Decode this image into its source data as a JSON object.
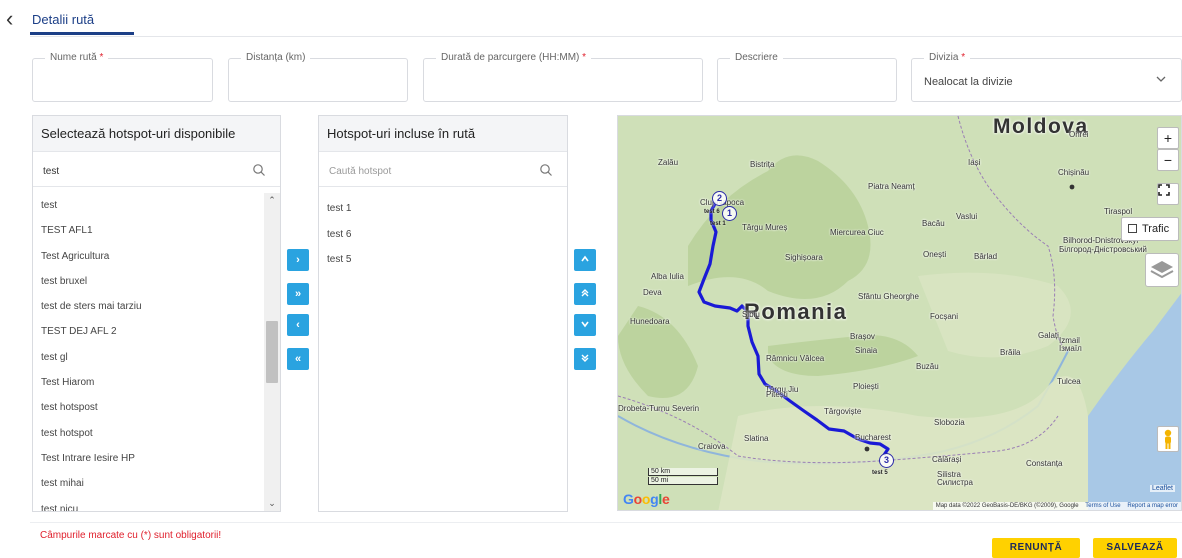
{
  "header": {
    "back_icon": "chevron-left-icon",
    "tab_label": "Detalii rută"
  },
  "form": {
    "route_name": {
      "label": "Nume rută",
      "required_mark": "*",
      "value": ""
    },
    "distance": {
      "label": "Distanța (km)",
      "value": ""
    },
    "duration": {
      "label": "Durată de parcurgere (HH:MM)",
      "required_mark": "*",
      "value": ""
    },
    "description": {
      "label": "Descriere",
      "value": ""
    },
    "division": {
      "label": "Divizia",
      "required_mark": "*",
      "value": "Nealocat la divizie"
    }
  },
  "available": {
    "title": "Selectează hotspot-uri disponibile",
    "search_value": "test",
    "items": [
      "test",
      "TEST AFL1",
      "Test Agricultura",
      "test bruxel",
      "test de sters mai tarziu",
      "TEST DEJ AFL 2",
      "test gl",
      "Test Hiarom",
      "test hotspost",
      "test hotspot",
      "Test Intrare Iesire HP",
      "test mihai",
      "test nicu"
    ]
  },
  "transfer_buttons": {
    "move_right": "›",
    "move_all_right": "»",
    "move_left": "‹",
    "move_all_left": "«"
  },
  "included": {
    "title": "Hotspot-uri incluse în rută",
    "search_placeholder": "Caută hotspot",
    "items": [
      "test 1",
      "test 6",
      "test 5"
    ]
  },
  "order_buttons": {
    "up": "˄",
    "top": "«",
    "down": "˅",
    "bottom": "»"
  },
  "map": {
    "country_labels": {
      "moldova": "Moldova",
      "romania": "Romania"
    },
    "city_labels": [
      "Zalău",
      "Bistrița",
      "Piatra Neamț",
      "Iași",
      "Chișinău",
      "Cluj-Napoca",
      "Târgu Mureș",
      "Bacău",
      "Vaslui",
      "Tiraspol",
      "Miercurea Ciuc",
      "Onești",
      "Bârlad",
      "Bilhorod-Dnistrovskyi",
      "Білгород-Дністровський",
      "Sighișoara",
      "Alba Iulia",
      "Deva",
      "Hunedoara",
      "Sibiu",
      "Sfântu Gheorghe",
      "Focșani",
      "Brașov",
      "Sinaia",
      "Galați",
      "Izmail",
      "Ізмаїл",
      "Brăila",
      "Râmnicu Vâlcea",
      "Târgu Jiu",
      "Buzău",
      "Tulcea",
      "Ploiești",
      "Pitești",
      "Târgoviște",
      "Drobeta-Turnu Severin",
      "Slobozia",
      "Slatina",
      "Craiova",
      "Bucharest",
      "Călărași",
      "Constanța",
      "Silistra",
      "Силистра",
      "Ohrei"
    ],
    "zoom_in": "+",
    "zoom_out": "−",
    "traffic_label": "Trafic",
    "markers": [
      {
        "num": "1",
        "label": "test 1"
      },
      {
        "num": "2",
        "label": "test 6"
      },
      {
        "num": "3",
        "label": "test 5"
      }
    ],
    "scale_km": "50 km",
    "scale_mi": "50 mi",
    "leaflet": "Leaflet",
    "attribution": "Map data ©2022 GeoBasis-DE/BKG (©2009), Google",
    "terms": "Terms of Use",
    "report": "Report a map error",
    "google": [
      "G",
      "o",
      "o",
      "g",
      "l",
      "e"
    ],
    "google_colors": [
      "#4285F4",
      "#EA4335",
      "#FBBC05",
      "#4285F4",
      "#34A853",
      "#EA4335"
    ],
    "route_color": "#1a1ad6"
  },
  "footer": {
    "required_note": "Câmpurile marcate cu (*) sunt obligatorii!",
    "cancel_label": "RENUNȚĂ",
    "save_label": "SALVEAZĂ"
  }
}
